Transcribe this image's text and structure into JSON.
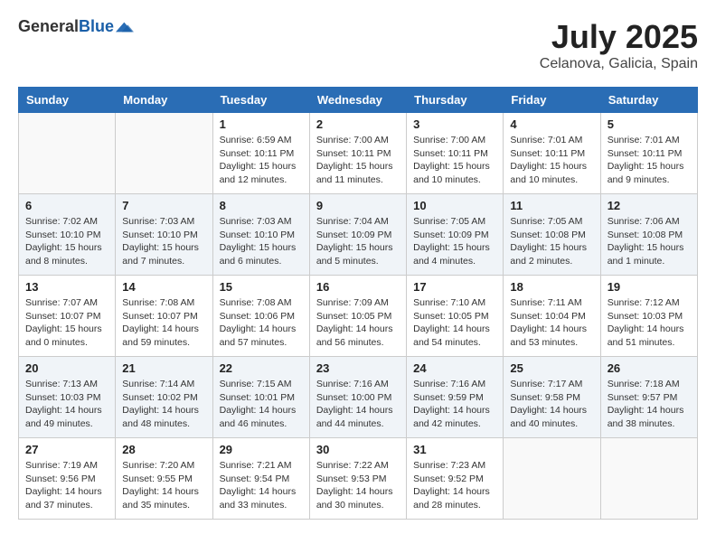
{
  "logo": {
    "general": "General",
    "blue": "Blue"
  },
  "title": "July 2025",
  "location": "Celanova, Galicia, Spain",
  "days_of_week": [
    "Sunday",
    "Monday",
    "Tuesday",
    "Wednesday",
    "Thursday",
    "Friday",
    "Saturday"
  ],
  "weeks": [
    [
      {
        "day": "",
        "info": ""
      },
      {
        "day": "",
        "info": ""
      },
      {
        "day": "1",
        "info": "Sunrise: 6:59 AM\nSunset: 10:11 PM\nDaylight: 15 hours and 12 minutes."
      },
      {
        "day": "2",
        "info": "Sunrise: 7:00 AM\nSunset: 10:11 PM\nDaylight: 15 hours and 11 minutes."
      },
      {
        "day": "3",
        "info": "Sunrise: 7:00 AM\nSunset: 10:11 PM\nDaylight: 15 hours and 10 minutes."
      },
      {
        "day": "4",
        "info": "Sunrise: 7:01 AM\nSunset: 10:11 PM\nDaylight: 15 hours and 10 minutes."
      },
      {
        "day": "5",
        "info": "Sunrise: 7:01 AM\nSunset: 10:11 PM\nDaylight: 15 hours and 9 minutes."
      }
    ],
    [
      {
        "day": "6",
        "info": "Sunrise: 7:02 AM\nSunset: 10:10 PM\nDaylight: 15 hours and 8 minutes."
      },
      {
        "day": "7",
        "info": "Sunrise: 7:03 AM\nSunset: 10:10 PM\nDaylight: 15 hours and 7 minutes."
      },
      {
        "day": "8",
        "info": "Sunrise: 7:03 AM\nSunset: 10:10 PM\nDaylight: 15 hours and 6 minutes."
      },
      {
        "day": "9",
        "info": "Sunrise: 7:04 AM\nSunset: 10:09 PM\nDaylight: 15 hours and 5 minutes."
      },
      {
        "day": "10",
        "info": "Sunrise: 7:05 AM\nSunset: 10:09 PM\nDaylight: 15 hours and 4 minutes."
      },
      {
        "day": "11",
        "info": "Sunrise: 7:05 AM\nSunset: 10:08 PM\nDaylight: 15 hours and 2 minutes."
      },
      {
        "day": "12",
        "info": "Sunrise: 7:06 AM\nSunset: 10:08 PM\nDaylight: 15 hours and 1 minute."
      }
    ],
    [
      {
        "day": "13",
        "info": "Sunrise: 7:07 AM\nSunset: 10:07 PM\nDaylight: 15 hours and 0 minutes."
      },
      {
        "day": "14",
        "info": "Sunrise: 7:08 AM\nSunset: 10:07 PM\nDaylight: 14 hours and 59 minutes."
      },
      {
        "day": "15",
        "info": "Sunrise: 7:08 AM\nSunset: 10:06 PM\nDaylight: 14 hours and 57 minutes."
      },
      {
        "day": "16",
        "info": "Sunrise: 7:09 AM\nSunset: 10:05 PM\nDaylight: 14 hours and 56 minutes."
      },
      {
        "day": "17",
        "info": "Sunrise: 7:10 AM\nSunset: 10:05 PM\nDaylight: 14 hours and 54 minutes."
      },
      {
        "day": "18",
        "info": "Sunrise: 7:11 AM\nSunset: 10:04 PM\nDaylight: 14 hours and 53 minutes."
      },
      {
        "day": "19",
        "info": "Sunrise: 7:12 AM\nSunset: 10:03 PM\nDaylight: 14 hours and 51 minutes."
      }
    ],
    [
      {
        "day": "20",
        "info": "Sunrise: 7:13 AM\nSunset: 10:03 PM\nDaylight: 14 hours and 49 minutes."
      },
      {
        "day": "21",
        "info": "Sunrise: 7:14 AM\nSunset: 10:02 PM\nDaylight: 14 hours and 48 minutes."
      },
      {
        "day": "22",
        "info": "Sunrise: 7:15 AM\nSunset: 10:01 PM\nDaylight: 14 hours and 46 minutes."
      },
      {
        "day": "23",
        "info": "Sunrise: 7:16 AM\nSunset: 10:00 PM\nDaylight: 14 hours and 44 minutes."
      },
      {
        "day": "24",
        "info": "Sunrise: 7:16 AM\nSunset: 9:59 PM\nDaylight: 14 hours and 42 minutes."
      },
      {
        "day": "25",
        "info": "Sunrise: 7:17 AM\nSunset: 9:58 PM\nDaylight: 14 hours and 40 minutes."
      },
      {
        "day": "26",
        "info": "Sunrise: 7:18 AM\nSunset: 9:57 PM\nDaylight: 14 hours and 38 minutes."
      }
    ],
    [
      {
        "day": "27",
        "info": "Sunrise: 7:19 AM\nSunset: 9:56 PM\nDaylight: 14 hours and 37 minutes."
      },
      {
        "day": "28",
        "info": "Sunrise: 7:20 AM\nSunset: 9:55 PM\nDaylight: 14 hours and 35 minutes."
      },
      {
        "day": "29",
        "info": "Sunrise: 7:21 AM\nSunset: 9:54 PM\nDaylight: 14 hours and 33 minutes."
      },
      {
        "day": "30",
        "info": "Sunrise: 7:22 AM\nSunset: 9:53 PM\nDaylight: 14 hours and 30 minutes."
      },
      {
        "day": "31",
        "info": "Sunrise: 7:23 AM\nSunset: 9:52 PM\nDaylight: 14 hours and 28 minutes."
      },
      {
        "day": "",
        "info": ""
      },
      {
        "day": "",
        "info": ""
      }
    ]
  ]
}
